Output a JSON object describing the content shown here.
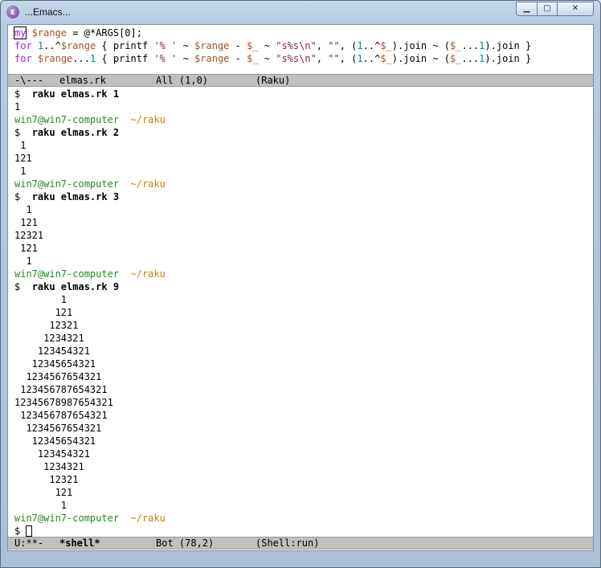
{
  "window": {
    "title": "...Emacs...",
    "icon": "emacs-icon",
    "buttons": {
      "minimize": "▁",
      "maximize": "▢",
      "close": "✕"
    }
  },
  "code": {
    "line1": {
      "kw": "my",
      "rest1": " ",
      "var": "$range",
      "rest2": " = @*ARGS[0];"
    },
    "line2": {
      "kw": "for",
      "a": " ",
      "n1": "1",
      "b": "..^",
      "v1": "$range",
      "c": " { printf ",
      "s1": "'% '",
      "d": " ~ ",
      "v2": "$range",
      "e": " - ",
      "v3": "$_",
      "f": " ~ ",
      "s2": "\"s%s\\n\"",
      "g": ", ",
      "s3": "\"\"",
      "h": ", (",
      "n2": "1",
      "i": "..^",
      "v4": "$_",
      "j": ").join ~ (",
      "v5": "$_",
      "k": "...",
      "n3": "1",
      "l": ").join }"
    },
    "line3": {
      "kw": "for",
      "a": " ",
      "v0": "$range",
      "b": "...",
      "n1": "1",
      "c": " { printf ",
      "s1": "'% '",
      "d": " ~ ",
      "v2": "$range",
      "e": " - ",
      "v3": "$_",
      "f": " ~ ",
      "s2": "\"s%s\\n\"",
      "g": ", ",
      "s3": "\"\"",
      "h": ", (",
      "n2": "1",
      "i": "..^",
      "v4": "$_",
      "j": ").join ~ (",
      "v5": "$_",
      "k": "...",
      "n3": "1",
      "l": ").join }"
    }
  },
  "modeline_top": {
    "status": "-\\---",
    "buffer": "elmas.rk",
    "position": "All (1,0)",
    "mode": "(Raku)"
  },
  "shell": {
    "prompt_user": "win7@win7-computer",
    "prompt_dir": "~/raku",
    "dollar": "$",
    "cmd1": "raku elmas.rk 1",
    "out1": [
      "1"
    ],
    "cmd2": "raku elmas.rk 2",
    "out2": [
      " 1",
      "121",
      " 1"
    ],
    "cmd3": "raku elmas.rk 3",
    "out3": [
      "  1",
      " 121",
      "12321",
      " 121",
      "  1"
    ],
    "cmd4": "raku elmas.rk 9",
    "out4": [
      "        1",
      "       121",
      "      12321",
      "     1234321",
      "    123454321",
      "   12345654321",
      "  1234567654321",
      " 123456787654321",
      "12345678987654321",
      " 123456787654321",
      "  1234567654321",
      "   12345654321",
      "    123454321",
      "     1234321",
      "      12321",
      "       121",
      "        1"
    ]
  },
  "modeline_bottom": {
    "status": "U:**-",
    "buffer": "*shell*",
    "position": "Bot (78,2)",
    "mode": "(Shell:run)"
  }
}
